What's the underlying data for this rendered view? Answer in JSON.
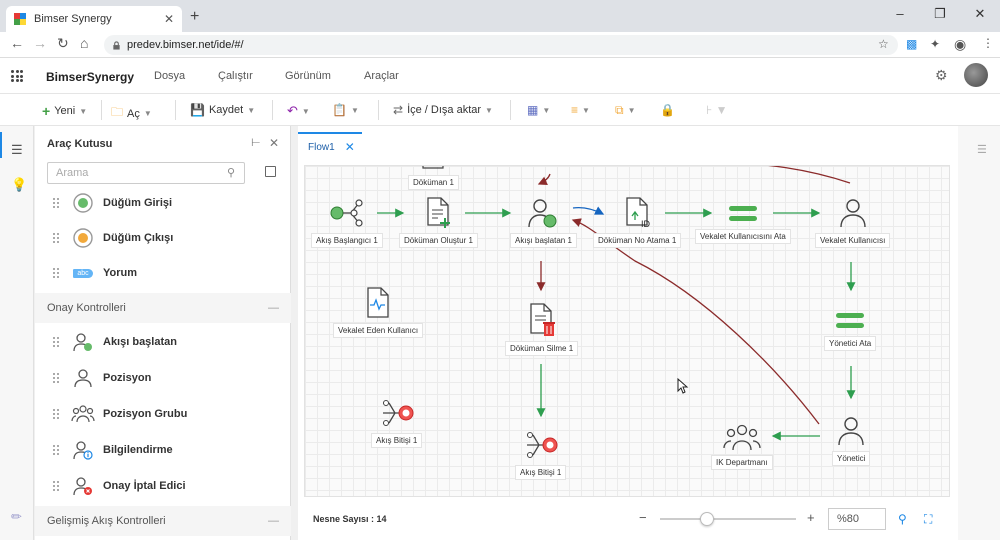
{
  "browser": {
    "tab_title": "Bimser Synergy",
    "url": "predev.bimser.net/ide/#/",
    "new_tab": "+",
    "close": "✕"
  },
  "app": {
    "name": "BimserSynergy",
    "menu": [
      "Dosya",
      "Çalıştır",
      "Görünüm",
      "Araçlar"
    ]
  },
  "toolbar": {
    "new_label": "Yeni",
    "open_label": "Aç",
    "save_label": "Kaydet",
    "import_export_label": "İçe / Dışa aktar"
  },
  "toolbox": {
    "title": "Araç Kutusu",
    "search_placeholder": "Arama",
    "items_top": [
      "Düğüm Girişi",
      "Düğüm Çıkışı",
      "Yorum"
    ],
    "comment_icon_text": "abc",
    "sections": [
      "Onay Kontrolleri",
      "Gelişmiş Akış Kontrolleri"
    ],
    "collapse_symbol": "—",
    "approval_items": [
      "Akışı başlatan",
      "Pozisyon",
      "Pozisyon Grubu",
      "Bilgilendirme",
      "Onay İptal Edici"
    ]
  },
  "editor": {
    "tab_label": "Flow1",
    "tab_close": "✕"
  },
  "nodes": {
    "start": "Akış Başlangıcı 1",
    "doc_top": "Döküman 1",
    "doc_create": "Döküman Oluştur 1",
    "initiator": "Akışı başlatan 1",
    "doc_number": "Döküman No Atama 1",
    "proxy_assign": "Vekalet Kullanıcısını Ata",
    "proxy_user": "Vekalet Kullanıcısı",
    "delegating_user": "Vekalet Eden Kullanıcı",
    "doc_delete": "Döküman Silme 1",
    "manager_assign": "Yönetici Ata",
    "end1": "Akış Bitişi 1",
    "end2": "Akış Bitişi 1",
    "hr_dept": "IK Departmanı",
    "manager": "Yönetici"
  },
  "statusbar": {
    "object_count": "Nesne Sayısı : 14",
    "zoom_minus": "−",
    "zoom_plus": "+",
    "zoom_value": "%80",
    "zoom_level": 0.8
  },
  "colors": {
    "accent": "#1e88e5",
    "flow_green": "#2e9e4f",
    "node_green": "#4caf50",
    "reject_red": "#c62828",
    "curve_brown": "#8b2b2b",
    "doc_blue": "#1565c0"
  }
}
